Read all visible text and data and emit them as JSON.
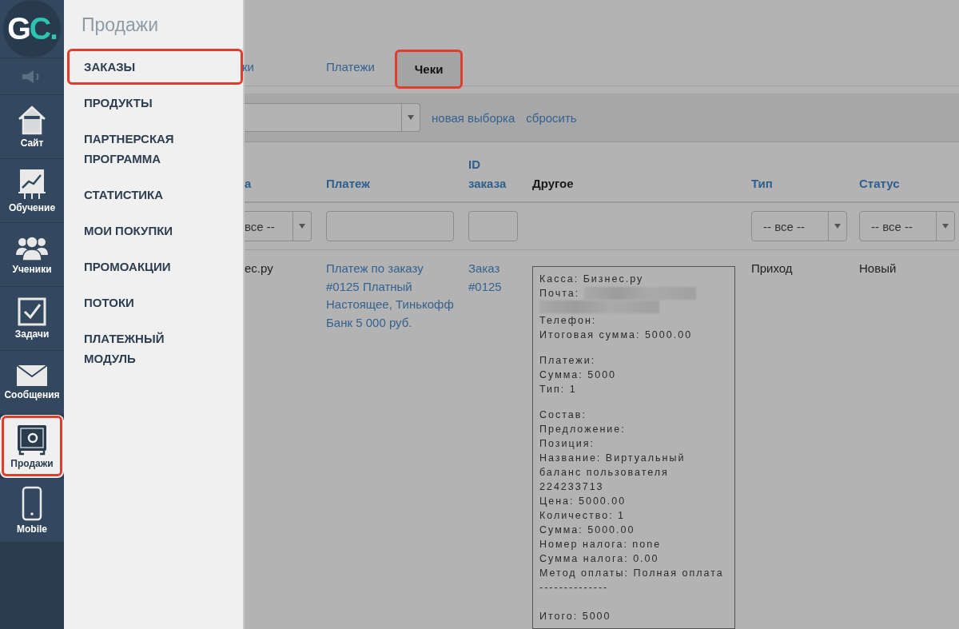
{
  "sidebar": {
    "logo": {
      "main": "G",
      "accent": "C."
    },
    "items": [
      {
        "kind": "sound",
        "selected": false,
        "highlighted": false
      },
      {
        "kind": "home",
        "label": "Сайт",
        "selected": false,
        "highlighted": false
      },
      {
        "kind": "chart",
        "label": "Обучение",
        "selected": false,
        "highlighted": false
      },
      {
        "kind": "people",
        "label": "Ученики",
        "selected": false,
        "highlighted": false
      },
      {
        "kind": "task",
        "label": "Задачи",
        "selected": false,
        "highlighted": false
      },
      {
        "kind": "mail",
        "label": "Сообщения",
        "selected": false,
        "highlighted": false
      },
      {
        "kind": "safe",
        "label": "Продажи",
        "selected": true,
        "highlighted": true
      },
      {
        "kind": "phone",
        "label": "Mobile",
        "selected": false,
        "highlighted": false
      }
    ]
  },
  "menu": {
    "title": "Продажи",
    "items": [
      {
        "label": "ЗАКАЗЫ",
        "highlighted": true
      },
      {
        "label": "ПРОДУКТЫ",
        "highlighted": false
      },
      {
        "label": "ПАРТНЕРСКАЯ ПРОГРАММА",
        "highlighted": false
      },
      {
        "label": "СТАТИСТИКА",
        "highlighted": false
      },
      {
        "label": "МОИ ПОКУПКИ",
        "highlighted": false
      },
      {
        "label": "ПРОМОАКЦИИ",
        "highlighted": false
      },
      {
        "label": "ПОТОКИ",
        "highlighted": false
      },
      {
        "label": "ПЛАТЕЖНЫЙ МОДУЛЬ",
        "highlighted": false
      }
    ]
  },
  "tabs": [
    {
      "label": "ки",
      "selected": false,
      "highlighted": false
    },
    {
      "label": "Платежи",
      "selected": false,
      "highlighted": false
    },
    {
      "label": "Чеки",
      "selected": true,
      "highlighted": true
    }
  ],
  "filter_bar": {
    "links": [
      "новая выборка",
      "сбросить"
    ]
  },
  "table": {
    "columns": [
      {
        "label": "а",
        "kind": "link"
      },
      {
        "label": "Платеж",
        "kind": "link"
      },
      {
        "label": "ID заказа",
        "kind": "link"
      },
      {
        "label": "Другое",
        "kind": "plain"
      },
      {
        "label": "Тип",
        "kind": "link"
      },
      {
        "label": "Статус",
        "kind": "link"
      }
    ],
    "filters": [
      {
        "kind": "select",
        "value": "все --"
      },
      {
        "kind": "input"
      },
      {
        "kind": "input"
      },
      {
        "kind": "none"
      },
      {
        "kind": "select",
        "value": "-- все --"
      },
      {
        "kind": "select",
        "value": "-- все --"
      }
    ],
    "rows": [
      {
        "cells": [
          {
            "kind": "text",
            "text": "ес.ру"
          },
          {
            "kind": "link",
            "text": "Платеж по заказу #0125 Платный Настоящее, Тинькофф Банк 5 000 руб."
          },
          {
            "kind": "link",
            "text": "Заказ #0125"
          },
          {
            "kind": "receipt",
            "lines": [
              {
                "kind": "line",
                "text": "Касса: Бизнес.ру"
              },
              {
                "kind": "line",
                "text": "Почта:",
                "redacted": true
              },
              {
                "kind": "redacted"
              },
              {
                "kind": "line",
                "text": "Телефон:"
              },
              {
                "kind": "line",
                "text": "Итоговая сумма: 5000.00"
              },
              {
                "kind": "gap"
              },
              {
                "kind": "line",
                "text": "Платежи:"
              },
              {
                "kind": "line",
                "text": "Сумма: 5000"
              },
              {
                "kind": "line",
                "text": "Тип: 1"
              },
              {
                "kind": "gap"
              },
              {
                "kind": "line",
                "text": "Состав:"
              },
              {
                "kind": "line",
                "text": "Предложение:"
              },
              {
                "kind": "line",
                "text": "Позиция:"
              },
              {
                "kind": "line",
                "text": "Название: Виртуальный баланс пользователя 224233713"
              },
              {
                "kind": "line",
                "text": "Цена: 5000.00"
              },
              {
                "kind": "line",
                "text": "Количество: 1"
              },
              {
                "kind": "line",
                "text": "Сумма: 5000.00"
              },
              {
                "kind": "line",
                "text": "Номер налога: none"
              },
              {
                "kind": "line",
                "text": "Сумма налога: 0.00"
              },
              {
                "kind": "line",
                "text": "Метод оплаты: Полная оплата"
              },
              {
                "kind": "line",
                "text": "--------------"
              },
              {
                "kind": "gap"
              },
              {
                "kind": "line",
                "text": "Итого: 5000"
              }
            ]
          },
          {
            "kind": "text",
            "text": "Приход"
          },
          {
            "kind": "text",
            "text": "Новый"
          }
        ]
      }
    ]
  }
}
